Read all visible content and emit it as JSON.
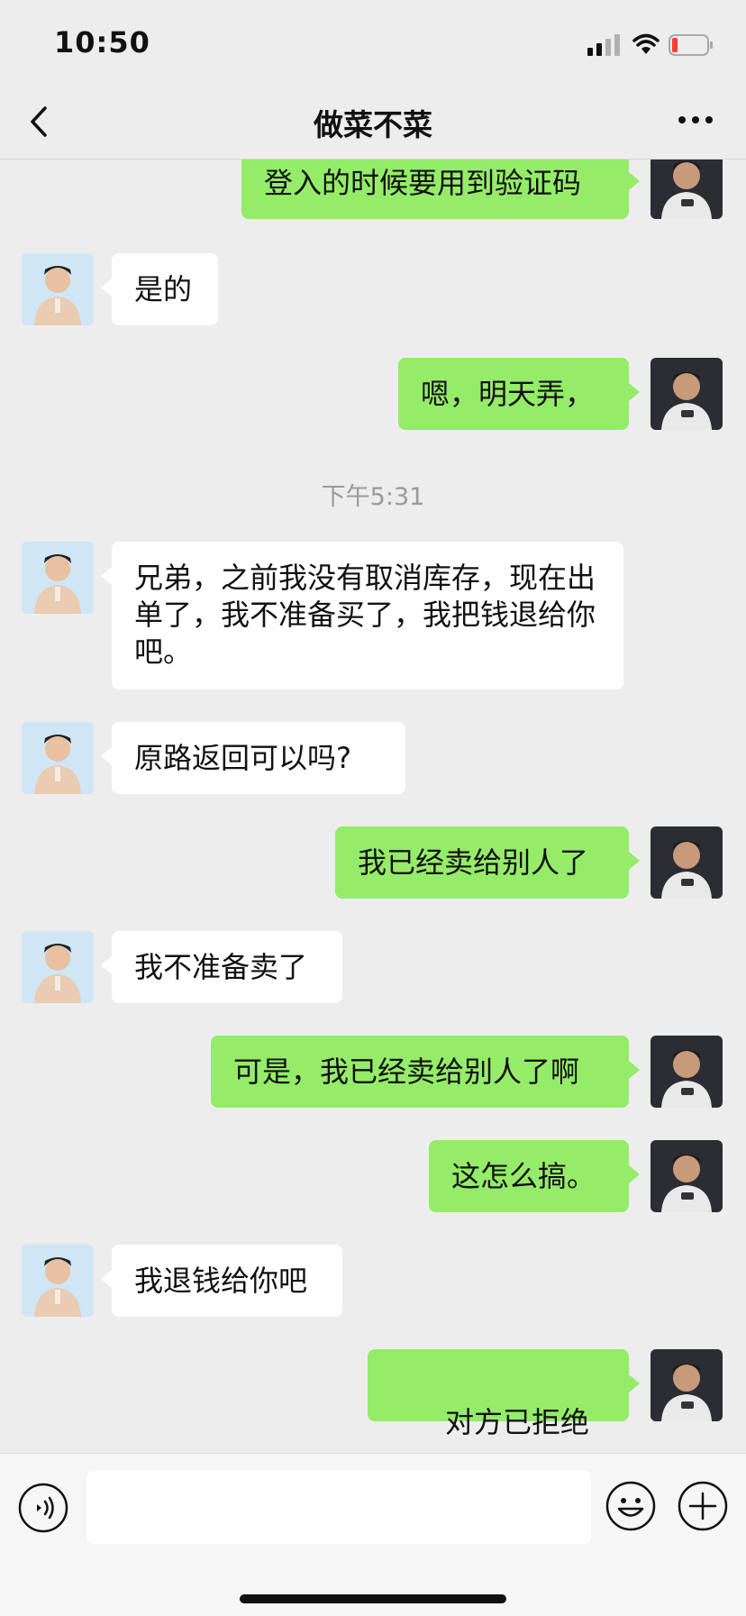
{
  "status_bar": {
    "time": "10:50"
  },
  "header": {
    "title": "做菜不菜"
  },
  "messages": {
    "m1": "登入的时候要用到验证码",
    "m2": "是的",
    "m3": "嗯，明天弄，",
    "timestamp": "下午5:31",
    "m4": "兄弟，之前我没有取消库存，现在出单了，我不准备买了，我把钱退给你吧。",
    "m5": "原路返回可以吗?",
    "m6": "我已经卖给别人了",
    "m7": "我不准备卖了",
    "m8": "可是，我已经卖给别人了啊",
    "m9": "这怎么搞。",
    "m10": "我退钱给你吧",
    "m11": "对方已拒绝"
  },
  "input": {
    "placeholder": ""
  },
  "colors": {
    "outgoing_bubble": "#95ec69",
    "incoming_bubble": "#ffffff",
    "background": "#ededed"
  },
  "icons": [
    "back-icon",
    "more-icon",
    "signal-icon",
    "wifi-icon",
    "battery-icon",
    "call-declined-icon",
    "voice-icon",
    "emoji-icon",
    "plus-icon"
  ]
}
